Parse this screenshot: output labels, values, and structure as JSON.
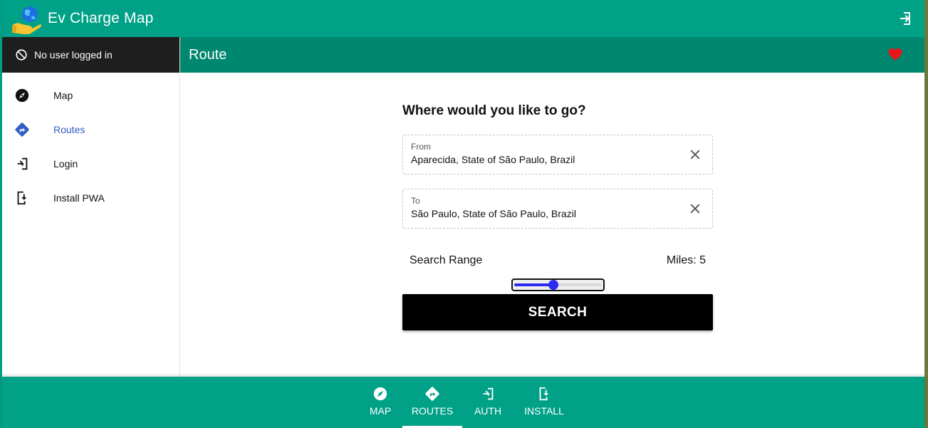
{
  "app": {
    "title": "Ev Charge Map"
  },
  "sidebar": {
    "user_status": "No user logged in",
    "items": [
      {
        "label": "Map",
        "icon": "compass-icon"
      },
      {
        "label": "Routes",
        "icon": "directions-icon",
        "active": true
      },
      {
        "label": "Login",
        "icon": "login-icon"
      },
      {
        "label": "Install PWA",
        "icon": "install-phone-icon"
      }
    ]
  },
  "header": {
    "title": "Route"
  },
  "form": {
    "heading": "Where would you like to go?",
    "from": {
      "label": "From",
      "value": "Aparecida, State of São Paulo, Brazil"
    },
    "to": {
      "label": "To",
      "value": "São Paulo, State of São Paulo, Brazil"
    },
    "range_label": "Search Range",
    "miles_label": "Miles: 5",
    "slider_fraction": 0.45,
    "search_label": "SEARCH"
  },
  "bottom_nav": {
    "items": [
      {
        "label": "MAP",
        "icon": "compass-icon"
      },
      {
        "label": "ROUTES",
        "icon": "directions-icon",
        "active": true
      },
      {
        "label": "AUTH",
        "icon": "login-icon"
      },
      {
        "label": "INSTALL",
        "icon": "install-phone-icon"
      }
    ]
  },
  "colors": {
    "primary": "#00a187",
    "primary_dark": "#008770",
    "active_link": "#2f5fc4",
    "heart": "#e8141c"
  }
}
